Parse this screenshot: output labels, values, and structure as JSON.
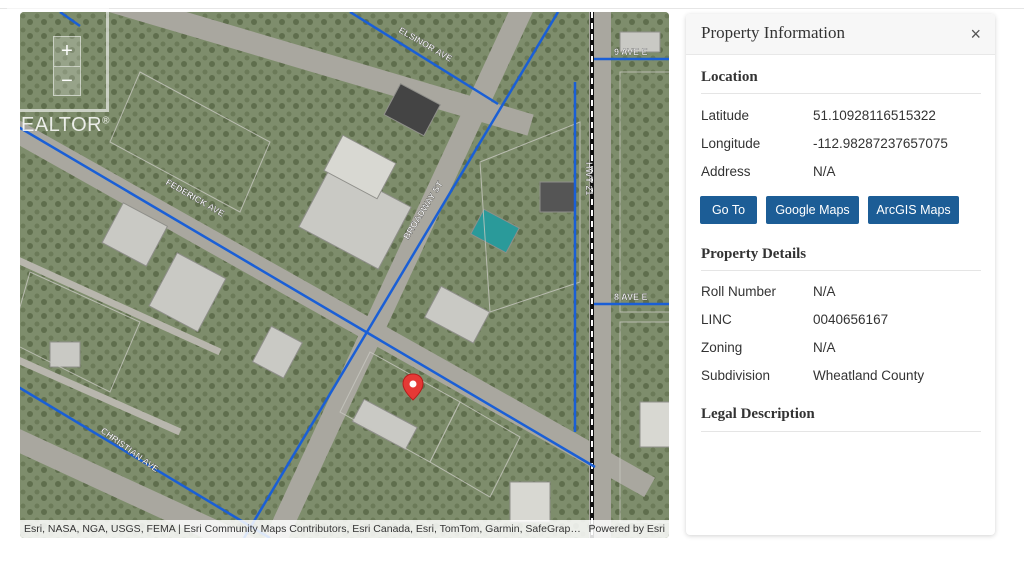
{
  "map": {
    "zoom_in": "+",
    "zoom_out": "−",
    "street_labels": [
      "ELSINOR AVE",
      "9 AVE E",
      "FEDERICK AVE",
      "BROADWAY ST",
      "HWY 21",
      "8 AVE E",
      "CHRISTIAN AVE"
    ],
    "attribution": "Esri, NASA, NGA, USGS, FEMA | Esri Community Maps Contributors, Esri Canada, Esri, TomTom, Garmin, SafeGrap…",
    "powered_by": "Powered by Esri",
    "marker_icon": "map-pin-icon",
    "marker_color": "#e53935",
    "road_color": "#1a5fd6"
  },
  "logo": {
    "text": "REALTOR",
    "mark": "®"
  },
  "panel": {
    "title": "Property Information",
    "close": "×",
    "location": {
      "title": "Location",
      "latitude_label": "Latitude",
      "latitude": "51.10928116515322",
      "longitude_label": "Longitude",
      "longitude": "-112.98287237657075",
      "address_label": "Address",
      "address": "N/A"
    },
    "buttons": {
      "go_to": "Go To",
      "google_maps": "Google Maps",
      "arcgis_maps": "ArcGIS Maps"
    },
    "details": {
      "title": "Property Details",
      "roll_label": "Roll Number",
      "roll": "N/A",
      "linc_label": "LINC",
      "linc": "0040656167",
      "zoning_label": "Zoning",
      "zoning": "N/A",
      "subdivision_label": "Subdivision",
      "subdivision": "Wheatland County"
    },
    "legal": {
      "title": "Legal Description"
    }
  },
  "colors": {
    "accent": "#1c5d96"
  }
}
